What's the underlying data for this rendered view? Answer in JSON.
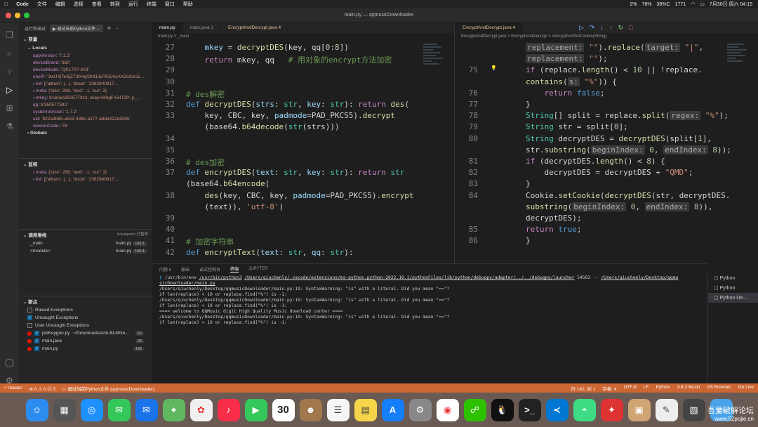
{
  "menubar": {
    "app": "Code",
    "items": [
      "文件",
      "编辑",
      "选择",
      "查看",
      "转到",
      "运行",
      "终端",
      "窗口",
      "帮助"
    ],
    "status": [
      "2%",
      "76%",
      "38%C",
      "1771",
      "7月30日 周六 04:15"
    ]
  },
  "window": {
    "title": "main.py — qqmusicDownloader"
  },
  "sidebar": {
    "header": "运行和调试",
    "run_config": "调试当前Python文件",
    "variables_title": "变量",
    "locals_title": "Locals",
    "locals": [
      {
        "k": "appVersion",
        "v": "'7.1.2'"
      },
      {
        "k": "deviceBrand",
        "v": "'360'"
      },
      {
        "k": "deviceModel",
        "v": "'QK1707-A01'"
      },
      {
        "k": "encIP",
        "v": "'3wUXjTeSjZ730Hq/SNt1JeTKEmxAXZsSxrJc..."
      },
      {
        "k": "list",
        "v": "[{'album': {...}, 'docid': '2362940817..."
      },
      {
        "k": "meta",
        "v": "{'size': 298, 'next': -1, 'cur': 3}"
      },
      {
        "k": "mkey",
        "v": "b'uinwo350577342; skey=M6gFr5HT2P; p_..."
      },
      {
        "k": "qq",
        "v": "b'350577342'"
      },
      {
        "k": "systemVersion",
        "v": "'1.7.2'"
      },
      {
        "k": "uid",
        "v": "'822a3b85-a5c9-438e-a277-a8da412e8265'"
      },
      {
        "k": "versionCode",
        "v": "'76'"
      }
    ],
    "globals_title": "Globals",
    "watch_title": "监视",
    "watch": [
      {
        "k": "meta",
        "v": "{'size': 298, 'next': -1, 'cur': 3}"
      },
      {
        "k": "list",
        "v": "[{'album': {...}, 'docid': '2362940817..."
      }
    ],
    "callstack_title": "调用堆栈",
    "callstack_status": "breakpoint 已暂停",
    "callstack": [
      {
        "name": "_main",
        "file": "main.py",
        "line": "142:1"
      },
      {
        "name": "<module>",
        "file": "main.py",
        "line": "145:1"
      }
    ],
    "breakpoints_title": "断点",
    "breakpoints": [
      {
        "label": "Raised Exceptions",
        "on": false
      },
      {
        "label": "Uncaught Exceptions",
        "on": true
      },
      {
        "label": "User Uncaught Exceptions",
        "on": false
      }
    ],
    "bp_files": [
      {
        "label": "jebKeygen.py",
        "path": "~/Downloads/Anti-BLM/ke...",
        "n": "60"
      },
      {
        "label": "main.java",
        "path": "",
        "n": "32"
      },
      {
        "label": "main.py",
        "path": "",
        "n": "142"
      }
    ]
  },
  "left_editor": {
    "tabs": [
      {
        "label": "main.py",
        "state": "active"
      },
      {
        "label": "main.java 1",
        "state": ""
      },
      {
        "label": "EncryptAndDecrypt.java 4",
        "state": "mod"
      }
    ],
    "breadcrumb": "main.py > _main",
    "lines": [
      {
        "n": "27",
        "html": "    <span class='pa'>mkey</span> = <span class='fn'>decryptDES</span>(key, qq[<span class='nu'>0</span>:<span class='nu'>8</span>])"
      },
      {
        "n": "28",
        "html": "    <span class='kw2'>return</span> mkey, qq   <span class='cm'># 用对象的encrypt方法加密</span>"
      },
      {
        "n": "29",
        "html": ""
      },
      {
        "n": "30",
        "html": ""
      },
      {
        "n": "31",
        "html": "<span class='cm'># des解密</span>"
      },
      {
        "n": "32",
        "html": "<span class='kw'>def</span> <span class='fn'>decryptDES</span>(<span class='pa'>strs</span>: <span class='cl'>str</span>, <span class='pa'>key</span>: <span class='cl'>str</span>): <span class='kw2'>return</span> <span class='fn'>des</span>("
      },
      {
        "n": "33",
        "html": "    key, CBC, key, <span class='pa'>padmode</span>=PAD_PKCS5).<span class='fn'>decrypt</span>"
      },
      {
        "n": "",
        "html": "    (base64.<span class='fn'>b64decode</span>(<span class='cl'>str</span>(strs)))"
      },
      {
        "n": "34",
        "html": ""
      },
      {
        "n": "35",
        "html": ""
      },
      {
        "n": "36",
        "html": "<span class='cm'># des加密</span>"
      },
      {
        "n": "37",
        "html": "<span class='kw'>def</span> <span class='fn'>encryptDES</span>(<span class='pa'>text</span>: <span class='cl'>str</span>, <span class='pa'>key</span>: <span class='cl'>str</span>): <span class='kw2'>return</span> <span class='cl'>str</span>"
      },
      {
        "n": "",
        "html": "(base64.<span class='fn'>b64encode</span>("
      },
      {
        "n": "38",
        "html": "    <span class='fn'>des</span>(key, CBC, key, <span class='pa'>padmode</span>=PAD_PKCS5).<span class='fn'>encrypt</span>"
      },
      {
        "n": "",
        "html": "    (text)), <span class='st'>'utf-8'</span>)"
      },
      {
        "n": "39",
        "html": ""
      },
      {
        "n": "40",
        "html": ""
      },
      {
        "n": "41",
        "html": "<span class='cm'># 加密字符串</span>"
      },
      {
        "n": "42",
        "html": "<span class='kw'>def</span> <span class='fn'>encryptText</span>(<span class='pa'>text</span>: <span class='cl'>str</span>, <span class='pa'>qq</span>: <span class='cl'>str</span>):"
      }
    ]
  },
  "right_editor": {
    "tabs": [
      {
        "label": "EncryptAndDecrypt.java 4",
        "state": "mod-active"
      }
    ],
    "breadcrumb": "EncryptAndDecrypt.java > EncryptAndDecrypt > decryptAndSetCookie(String)",
    "lines": [
      {
        "n": "",
        "html": "<span class='hint'>replacement:</span> <span class='st'>\"\"</span>).<span class='fn'>replace</span>(<span class='hint'>target:</span> <span class='st'>\"|\"</span>,"
      },
      {
        "n": "",
        "html": "<span class='hint'>replacement:</span> <span class='st'>\"\"</span>);"
      },
      {
        "n": "75",
        "html": "<span class='kw2'>if</span> (replace.<span class='fn'>length</span>() &lt; <span class='nu'>10</span> || !replace."
      },
      {
        "n": "",
        "html": "<span class='fn'>contains</span>(<span class='hint'>s:</span> <span class='st'>\"%\"</span>)) {"
      },
      {
        "n": "76",
        "html": "    <span class='kw2'>return</span> <span class='kw'>false</span>;"
      },
      {
        "n": "77",
        "html": "}"
      },
      {
        "n": "78",
        "html": "<span class='cl'>String</span>[] split = replace.<span class='fn'>split</span>(<span class='hint'>regex:</span> <span class='st'>\"%\"</span>);"
      },
      {
        "n": "79",
        "html": "<span class='cl'>String</span> str = split[<span class='nu'>0</span>];"
      },
      {
        "n": "80",
        "html": "<span class='cl'>String</span> decryptDES = <span class='fn'>decryptDES</span>(split[<span class='nu'>1</span>],"
      },
      {
        "n": "",
        "html": "str.<span class='fn'>substring</span>(<span class='hint'>beginIndex:</span> <span class='nu'>0</span>, <span class='hint'>endIndex:</span> <span class='nu'>8</span>));"
      },
      {
        "n": "81",
        "html": "<span class='kw2'>if</span> (decryptDES.<span class='fn'>length</span>() &lt; <span class='nu'>8</span>) {"
      },
      {
        "n": "82",
        "html": "    decryptDES = decryptDES + <span class='st'>\"QMD\"</span>;"
      },
      {
        "n": "83",
        "html": "}"
      },
      {
        "n": "84",
        "html": "Cookie.<span class='fn'>setCookie</span>(<span class='fn'>decryptDES</span>(str, decryptDES."
      },
      {
        "n": "",
        "html": "<span class='fn'>substring</span>(<span class='hint'>beginIndex:</span> <span class='nu'>0</span>, <span class='hint'>endIndex:</span> <span class='nu'>8</span>)),"
      },
      {
        "n": "",
        "html": "decryptDES);"
      },
      {
        "n": "85",
        "html": "<span class='kw2'>return</span> <span class='kw'>true</span>;"
      },
      {
        "n": "86",
        "html": "}"
      }
    ]
  },
  "panel": {
    "tabs": [
      "问题 5",
      "输出",
      "调试控制台",
      "终端",
      "JUPYTER"
    ],
    "active_tab": "终端",
    "terminal": [
      "<span class='p'>❯</span>  /usr/bin/env <span class='u'>/usr/bin/python3</span> <span class='u'>/Users/qiuchenly/.vscode/extensions/ms-python.python-2022.10.1/pythonFiles/lib/python/debugpy/adapter/../../debugpy/launcher</span> 54562 -- <span class='u'>/Users/qiuchenly/Desktop/qqmu</span>",
      "<span class='u'>sicDownloader/main.py</span>",
      "/Users/qiuchenly/Desktop/qqmusicDownloader/main.py:19: SyntaxWarning: \"is\" with a literal. Did you mean \"==\"?",
      "  if len(replace) &lt; 10 or replace.find(\"%\") is -1:",
      "/Users/qiuchenly/Desktop/qqmusicDownloader/main.py:19: SyntaxWarning: \"is\" with a literal. Did you mean \"==\"?",
      "  if len(replace) &lt; 10 or replace.find(\"%\") is -1:",
      "==== welcome to QQMusic digit High Quality Music download center ====",
      "/Users/qiuchenly/Desktop/qqmusicDownloader/main.py:19: SyntaxWarning: \"is\" with a literal. Did you mean \"==\"?",
      "  if len(replace) &lt; 10 or replace.find(\"%\") is -1:"
    ],
    "terminals": [
      "Python",
      "Python",
      "Python De..."
    ]
  },
  "statusbar": {
    "branch": "master",
    "errors": "⊗ 0 ⚠ 0 ⓪ 5",
    "debug": "调试当前Python文件 (qqmusicDownloader)",
    "right": [
      "行 142, 列 1",
      "空格: 4",
      "UTF-8",
      "LF",
      "Python",
      "3.8.2 64-bit",
      "VS Browser",
      "Go Live"
    ]
  },
  "watermark": {
    "text": "吾爱破解论坛",
    "url": "www.52pojie.cn"
  },
  "colors": {
    "statusbar": "#cc6633",
    "accent": "#0e639c"
  }
}
